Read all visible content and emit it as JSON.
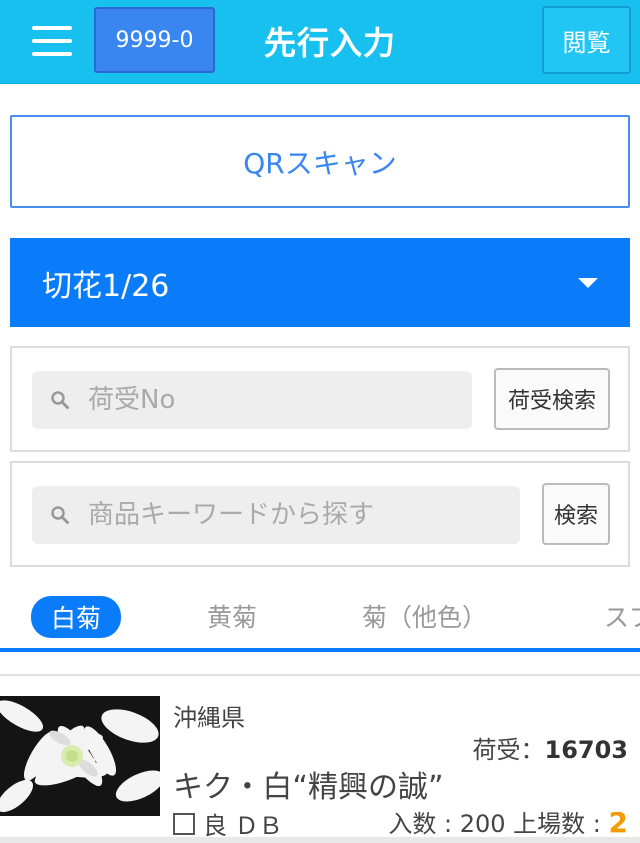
{
  "header": {
    "user_code": "9999-0",
    "title": "先行入力",
    "browse_label": "閲覧"
  },
  "qr_scan": {
    "label": "QRスキャン"
  },
  "category_select": {
    "selected": "切花1/26"
  },
  "receipt_search": {
    "placeholder": "荷受No",
    "button_label": "荷受検索"
  },
  "keyword_search": {
    "placeholder": "商品キーワードから探す",
    "button_label": "検索"
  },
  "tabs": [
    {
      "label": "白菊",
      "active": true
    },
    {
      "label": "黄菊",
      "active": false
    },
    {
      "label": "菊（他色）",
      "active": false
    },
    {
      "label": "スプ",
      "active": false
    }
  ],
  "product": {
    "origin": "沖縄県",
    "receipt_label": "荷受：",
    "receipt_no": "16703",
    "name": "キク・白“精興の誠”",
    "grade": "良 ＤＢ",
    "quantity_label": "入数 : 200 上場数 : ",
    "listed_count": "2"
  },
  "colors": {
    "header_bg": "#18c0f0",
    "primary_blue": "#0a7cfa",
    "accent_orange": "#f59a00"
  }
}
